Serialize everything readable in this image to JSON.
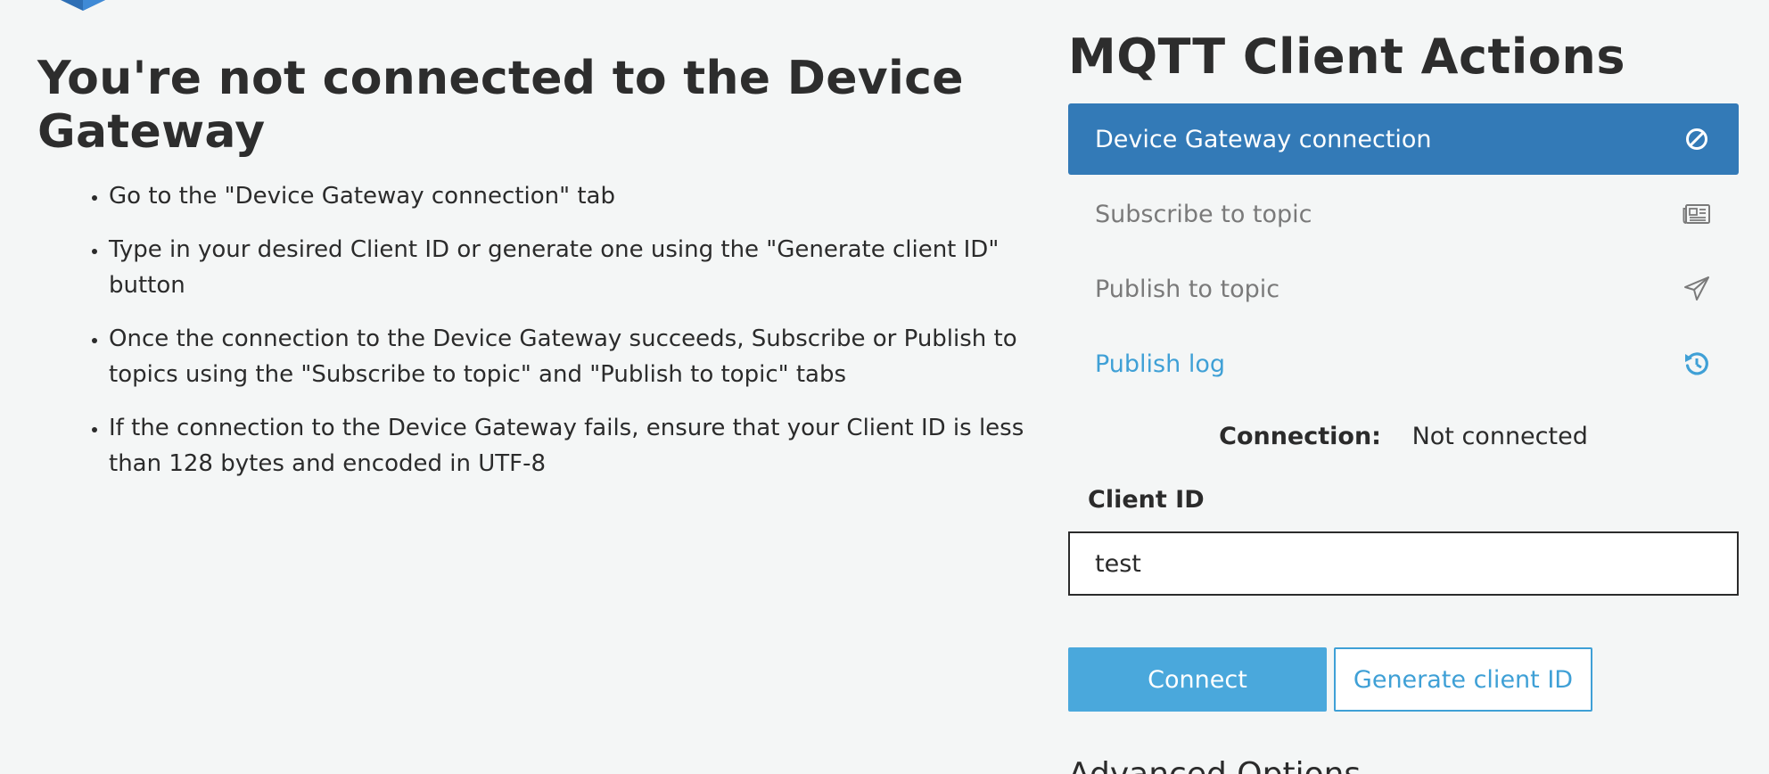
{
  "main": {
    "heading": "You're not connected to the Device Gateway",
    "instructions": [
      "Go to the \"Device Gateway connection\" tab",
      "Type in your desired Client ID or generate one using the \"Generate client ID\" button",
      "Once the connection to the Device Gateway succeeds, Subscribe or Publish to topics using the \"Subscribe to topic\" and \"Publish to topic\" tabs",
      "If the connection to the Device Gateway fails, ensure that your Client ID is less than 128 bytes and encoded in UTF-8"
    ]
  },
  "actions": {
    "title": "MQTT Client Actions",
    "tabs": [
      {
        "label": "Device Gateway connection",
        "icon": "ban-icon"
      },
      {
        "label": "Subscribe to topic",
        "icon": "newspaper-icon"
      },
      {
        "label": "Publish to topic",
        "icon": "paper-plane-icon"
      },
      {
        "label": "Publish log",
        "icon": "history-icon"
      }
    ],
    "connection_label": "Connection:",
    "connection_status": "Not connected",
    "client_id_label": "Client ID",
    "client_id_value": "test",
    "connect_label": "Connect",
    "generate_label": "Generate client ID",
    "advanced_label": "Advanced Options"
  },
  "colors": {
    "active_tab": "#337ab7",
    "link": "#3fa0d6",
    "primary_button": "#4aa8dc",
    "background": "#f4f6f6"
  }
}
